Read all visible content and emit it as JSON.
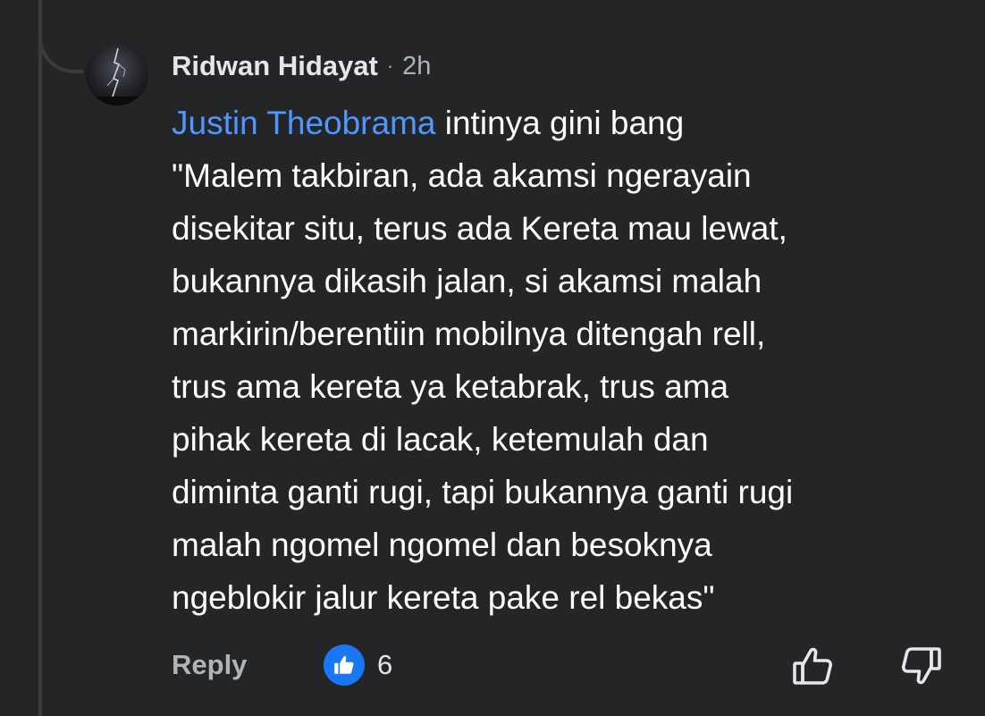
{
  "comment": {
    "author": "Ridwan Hidayat",
    "separator": "·",
    "timestamp": "2h",
    "mention": "Justin Theobrama",
    "first_line_rest": " intinya gini bang",
    "lines": [
      "\"Malem takbiran, ada akamsi ngerayain",
      "disekitar situ, terus ada Kereta mau lewat,",
      "bukannya dikasih jalan, si akamsi malah",
      "markirin/berentiin mobilnya ditengah rell,",
      "trus ama kereta ya ketabrak, trus ama",
      "pihak kereta di lacak, ketemulah dan",
      "diminta ganti rugi, tapi bukannya ganti rugi",
      "malah ngomel ngomel dan besoknya",
      "ngeblokir jalur kereta pake rel bekas\""
    ]
  },
  "actions": {
    "reply_label": "Reply",
    "like_count": "6",
    "like_icon": "thumbs-up-icon",
    "upvote_icon": "thumbs-up-outline-icon",
    "downvote_icon": "thumbs-down-outline-icon"
  },
  "colors": {
    "background": "#242526",
    "mention": "#4f96ff",
    "like_badge": "#1877f2",
    "secondary_text": "#b0b3b8"
  }
}
